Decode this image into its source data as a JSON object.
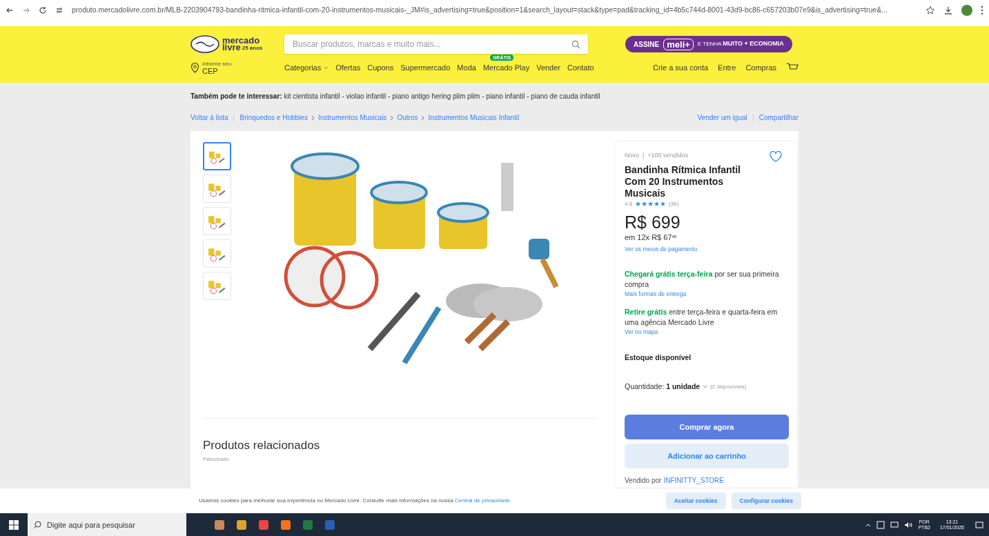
{
  "browser": {
    "url": "produto.mercadolivre.com.br/MLB-2203904793-bandinha-ritmica-infantil-com-20-instrumentos-musicais-_JM#is_advertising=true&position=1&search_layout=stack&type=pad&tracking_id=4b5c744d-8001-43d9-bc86-c657203b07e9&is_advertising=true&..."
  },
  "header": {
    "logo_line1": "mercado",
    "logo_line2": "livre",
    "logo_badge": "25 anos",
    "search": {
      "placeholder": "Buscar produtos, marcas e muito mais..."
    },
    "promo": {
      "lead": "ASSINE",
      "brand": "meli+",
      "tail": "E TENHA **MUITO + ECONOMIA**"
    },
    "location": {
      "line1": "Informe seu",
      "line2": "CEP"
    },
    "nav": [
      {
        "label": "Categorias",
        "kind": "dropdown"
      },
      {
        "label": "Ofertas",
        "kind": "link"
      },
      {
        "label": "Cupons",
        "kind": "link"
      },
      {
        "label": "Supermercado",
        "kind": "link"
      },
      {
        "label": "Moda",
        "kind": "link"
      },
      {
        "label": "Mercado Play",
        "kind": "badge",
        "badge": "GRÁTIS"
      },
      {
        "label": "Vender",
        "kind": "link"
      },
      {
        "label": "Contato",
        "kind": "link"
      }
    ],
    "account": [
      "Crie a sua conta",
      "Entre",
      "Compras"
    ]
  },
  "suggestions": "**Também pode te interessar:** kit cientista infantil - violao infantil - piano antigo hering plim plim - piano infantil - piano de cauda infantil",
  "breadcrumb": {
    "back": "Voltar à lista",
    "path": [
      "Brinquedos e Hobbies",
      "Instrumentos Musicais",
      "Outros",
      "Instrumentos Musicais Infantil"
    ],
    "actions": [
      "Vender um igual",
      "Compartilhar"
    ]
  },
  "gallery": {
    "thumbnails": [
      {
        "selected": true
      },
      {
        "selected": false
      },
      {
        "selected": false
      },
      {
        "selected": false
      },
      {
        "selected": false
      }
    ]
  },
  "product": {
    "condition": "Novo  |  +100 vendidos",
    "title": "Bandinha Rítmica Infantil Com 20 Instrumentos Musicais",
    "rating": "4.8",
    "stars": 5,
    "reviews": "(36)",
    "price": "R$ 699",
    "installments": "em 12x R$ 67$^{48}$",
    "payment_link": "Ver os meios de pagamento",
    "shipping": [
      {
        "text": "**Chegará grátis terça-feira** por ser sua primeira compra",
        "link": "Mais formas de entrega"
      },
      {
        "text": "**Retire grátis** entre terça-feira e quarta-feira em uma agência Mercado Livre",
        "link": "Ver no mapa"
      }
    ],
    "stock": "Estoque disponível",
    "quantity": "Quantidade: **1 unidade**",
    "available": "(2 disponíveis)",
    "buy": "Comprar agora",
    "cart": "Adicionar ao carrinho",
    "seller_label": "Vendido por",
    "seller": "INFINITTY_STORE"
  },
  "related": {
    "title": "Produtos relacionados",
    "subtitle": "Patrocinado"
  },
  "cookies": {
    "text": "Usamos cookies para melhorar sua experiência no Mercado Livre. Consulte mais informações na nossa",
    "link": "Central de privacidade.",
    "buttons": [
      "Aceitar cookies",
      "Configurar cookies"
    ]
  },
  "taskbar": {
    "search": {
      "placeholder": "Digite aqui para pesquisar"
    },
    "lang1": "POR",
    "lang2": "PTB2",
    "time": "13:21",
    "date": "17/01/2025"
  }
}
